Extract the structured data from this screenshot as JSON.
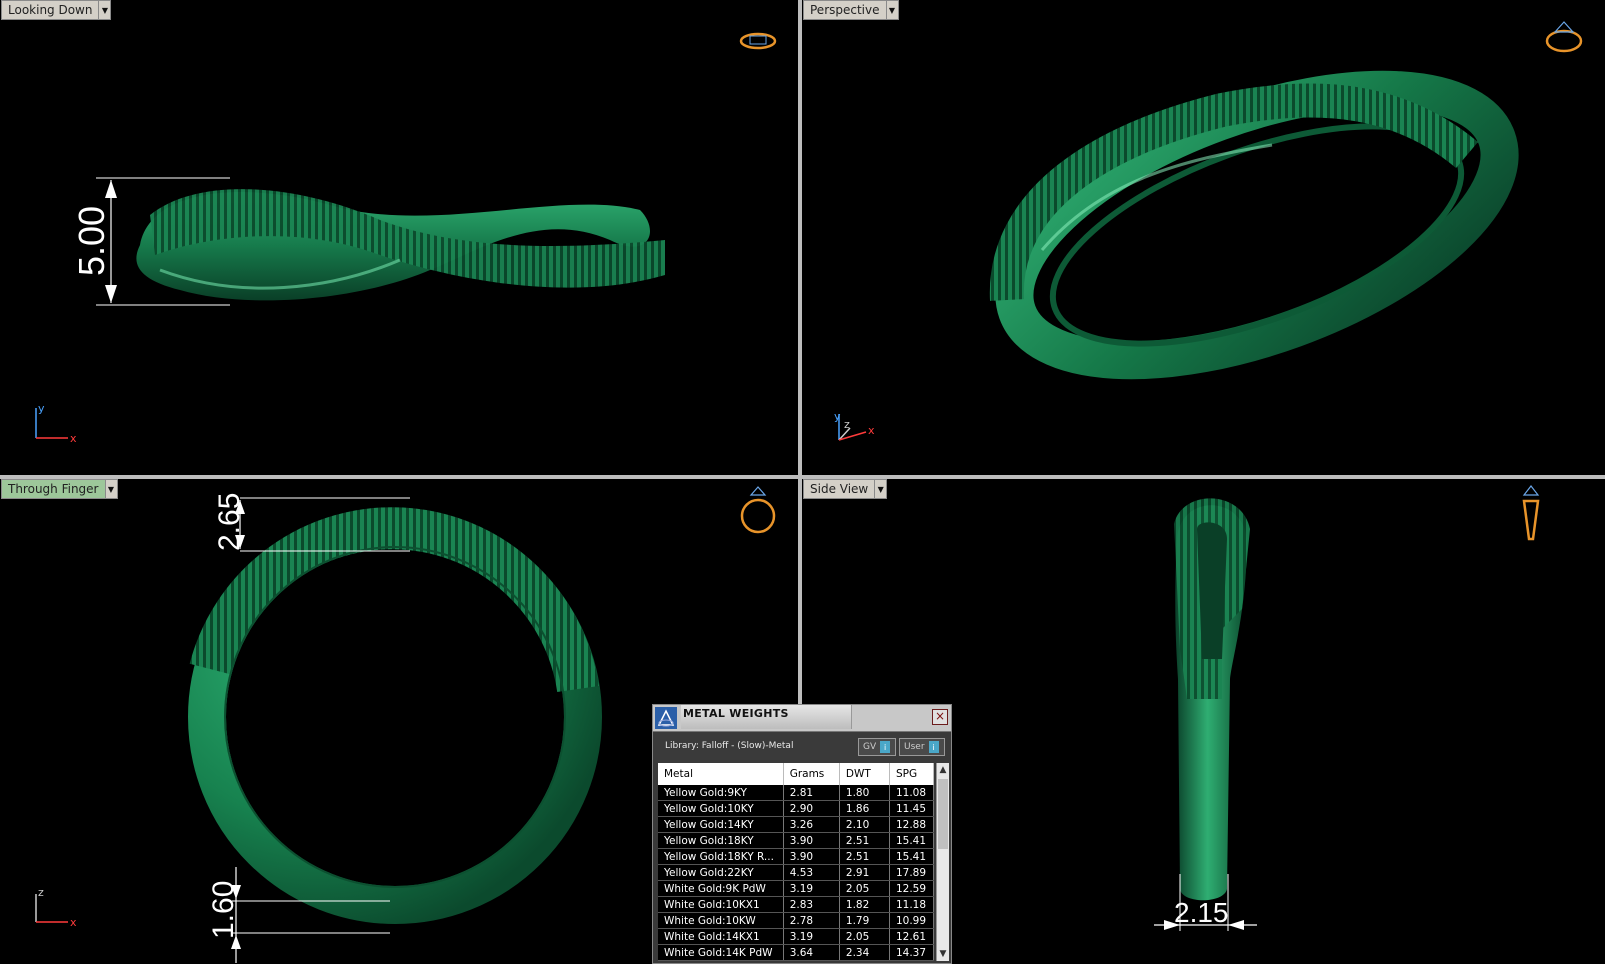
{
  "viewports": {
    "top_left": {
      "label": "Looking Down",
      "dimension": "5.00",
      "axes": [
        "y",
        "x"
      ]
    },
    "top_right": {
      "label": "Perspective",
      "axes": [
        "y",
        "z",
        "x"
      ]
    },
    "bottom_left": {
      "label": "Through Finger",
      "dimension_top": "2.65",
      "dimension_bottom": "1.60",
      "axes": [
        "z",
        "x"
      ]
    },
    "bottom_right": {
      "label": "Side View",
      "dimension": "2.15"
    }
  },
  "metal_weights": {
    "title": "METAL WEIGHTS",
    "close": "×",
    "library": "Library: Falloff - (Slow)-Metal",
    "toggle_gv": "GV",
    "toggle_user": "User",
    "toggle_icon": "i",
    "columns": [
      "Metal",
      "Grams",
      "DWT",
      "SPG"
    ],
    "rows": [
      [
        "Yellow Gold:9KY",
        "2.81",
        "1.80",
        "11.08"
      ],
      [
        "Yellow Gold:10KY",
        "2.90",
        "1.86",
        "11.45"
      ],
      [
        "Yellow Gold:14KY",
        "3.26",
        "2.10",
        "12.88"
      ],
      [
        "Yellow Gold:18KY",
        "3.90",
        "2.51",
        "15.41"
      ],
      [
        "Yellow Gold:18KY R...",
        "3.90",
        "2.51",
        "15.41"
      ],
      [
        "Yellow Gold:22KY",
        "4.53",
        "2.91",
        "17.89"
      ],
      [
        "White Gold:9K PdW",
        "3.19",
        "2.05",
        "12.59"
      ],
      [
        "White Gold:10KX1",
        "2.83",
        "1.82",
        "11.18"
      ],
      [
        "White Gold:10KW",
        "2.78",
        "1.79",
        "10.99"
      ],
      [
        "White Gold:14KX1",
        "3.19",
        "2.05",
        "12.61"
      ],
      [
        "White Gold:14K PdW",
        "3.64",
        "2.34",
        "14.37"
      ]
    ]
  },
  "colors": {
    "ring": "#1f8a5a",
    "ring_dark": "#0c4a2e",
    "ring_light": "#5fd39a",
    "active_label": "#9dc79a"
  }
}
